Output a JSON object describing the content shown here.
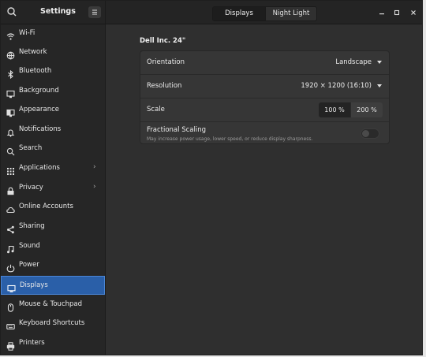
{
  "header": {
    "title": "Settings",
    "menu_icon": "hamburger-icon",
    "search_icon": "search-icon",
    "tabs": [
      {
        "label": "Displays",
        "active": true
      },
      {
        "label": "Night Light",
        "active": false
      }
    ],
    "window_controls": {
      "minimize": "–",
      "maximize": "□",
      "close": "✕"
    }
  },
  "sidebar": {
    "items": [
      {
        "label": "Wi-Fi",
        "icon": "wifi-icon"
      },
      {
        "label": "Network",
        "icon": "network-icon"
      },
      {
        "label": "Bluetooth",
        "icon": "bluetooth-icon"
      },
      {
        "label": "Background",
        "icon": "background-icon"
      },
      {
        "label": "Appearance",
        "icon": "appearance-icon"
      },
      {
        "label": "Notifications",
        "icon": "bell-icon"
      },
      {
        "label": "Search",
        "icon": "search-icon"
      },
      {
        "label": "Applications",
        "icon": "grid-icon",
        "chevron": "›"
      },
      {
        "label": "Privacy",
        "icon": "privacy-icon",
        "chevron": "›"
      },
      {
        "label": "Online Accounts",
        "icon": "cloud-icon"
      },
      {
        "label": "Sharing",
        "icon": "share-icon"
      },
      {
        "label": "Sound",
        "icon": "music-note-icon"
      },
      {
        "label": "Power",
        "icon": "power-icon"
      },
      {
        "label": "Displays",
        "icon": "display-icon",
        "selected": true
      },
      {
        "label": "Mouse & Touchpad",
        "icon": "mouse-icon"
      },
      {
        "label": "Keyboard Shortcuts",
        "icon": "keyboard-icon"
      },
      {
        "label": "Printers",
        "icon": "printer-icon"
      }
    ]
  },
  "display": {
    "monitor_name": "Dell Inc. 24\"",
    "orientation": {
      "label": "Orientation",
      "value": "Landscape"
    },
    "resolution": {
      "label": "Resolution",
      "value": "1920 × 1200 (16:10)"
    },
    "scale": {
      "label": "Scale",
      "options": [
        "100 %",
        "200 %"
      ],
      "selected": "100 %"
    },
    "fractional_scaling": {
      "label": "Fractional Scaling",
      "description": "May increase power usage, lower speed, or reduce display sharpness.",
      "enabled": false
    }
  },
  "colors": {
    "accent": "#2a5fa8",
    "window_bg": "#2f2f2f",
    "sidebar_bg": "#262626"
  }
}
